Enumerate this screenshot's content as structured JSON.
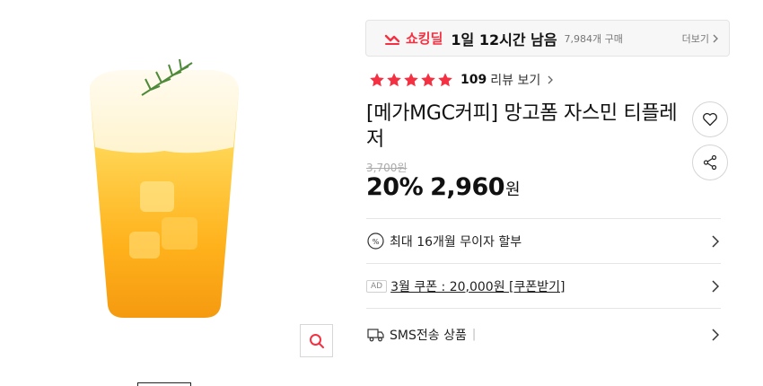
{
  "deal": {
    "label": "쇼킹딜",
    "time_left": "1일 12시간 남음",
    "purchase_count": "7,984개 구매",
    "more_label": "더보기",
    "accent_color": "#f43142"
  },
  "rating": {
    "stars": 5,
    "review_count": "109",
    "review_link": "리뷰 보기"
  },
  "product": {
    "title": "[메가MGC커피] 망고폼 자스민 티플레저",
    "original_price": "3,700원",
    "discount": "20%",
    "sale_price": "2,960",
    "currency": "원"
  },
  "actions": {
    "like_icon": "heart-icon",
    "share_icon": "share-icon",
    "zoom_icon": "magnifier-icon"
  },
  "options": {
    "installment": "최대 16개월 무이자 할부",
    "ad_badge": "AD",
    "coupon": "3월 쿠폰 : 20,000원 [쿠폰받기]",
    "sms": "SMS전송 상품",
    "sms_separator": "|"
  }
}
